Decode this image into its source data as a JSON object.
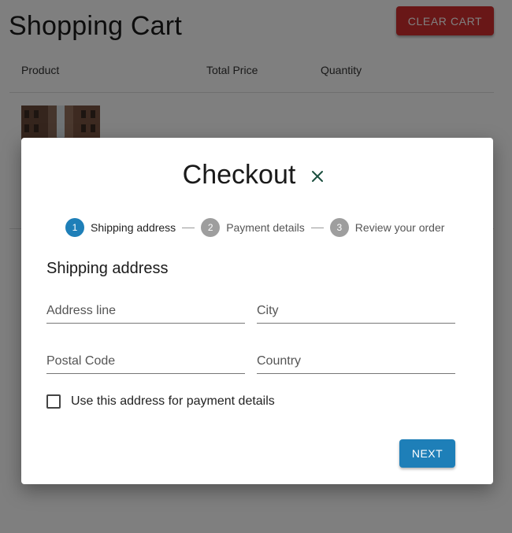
{
  "cart": {
    "title": "Shopping Cart",
    "clear_label": "CLEAR CART",
    "columns": [
      "Product",
      "Total Price",
      "Quantity"
    ]
  },
  "checkout": {
    "title": "Checkout",
    "close_icon": "close-icon",
    "steps": [
      {
        "number": "1",
        "label": "Shipping address",
        "active": true
      },
      {
        "number": "2",
        "label": "Payment details",
        "active": false
      },
      {
        "number": "3",
        "label": "Review your order",
        "active": false
      }
    ],
    "section_title": "Shipping address",
    "fields": {
      "address": {
        "placeholder": "Address line",
        "value": ""
      },
      "city": {
        "placeholder": "City",
        "value": ""
      },
      "postal": {
        "placeholder": "Postal Code",
        "value": ""
      },
      "country": {
        "placeholder": "Country",
        "value": ""
      }
    },
    "checkbox_label": "Use this address for payment details",
    "checkbox_checked": false,
    "next_label": "NEXT"
  },
  "colors": {
    "active_step": "#1e7fb8",
    "inactive_step": "#9e9e9e",
    "clear_button": "#d32f2f",
    "next_button": "#1e7fb8",
    "close_icon": "#1b4f3f"
  }
}
